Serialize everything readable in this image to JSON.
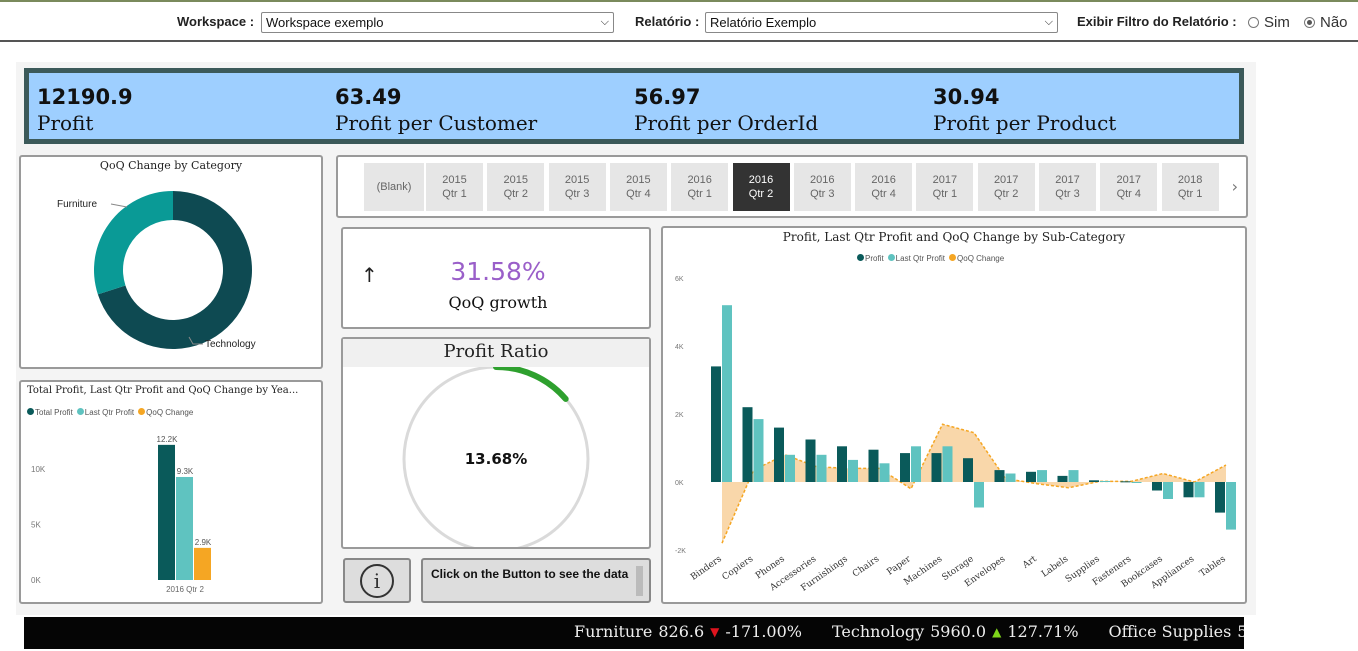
{
  "toolbar": {
    "workspace_label": "Workspace :",
    "workspace_value": "Workspace exemplo",
    "report_label": "Relatório :",
    "report_value": "Relatório Exemplo",
    "filter_label": "Exibir Filtro do Relatório :",
    "filter_options": [
      "Sim",
      "Não"
    ],
    "filter_selected": "Não"
  },
  "kpis": [
    {
      "value": "12190.9",
      "label": "Profit"
    },
    {
      "value": "63.49",
      "label": "Profit per Customer"
    },
    {
      "value": "56.97",
      "label": "Profit per OrderId"
    },
    {
      "value": "30.94",
      "label": "Profit per Product"
    }
  ],
  "donut": {
    "title": "QoQ Change by Category",
    "labels": [
      "Furniture",
      "Technology"
    ]
  },
  "quarter_slicer": {
    "items": [
      {
        "y": "(Blank)",
        "q": ""
      },
      {
        "y": "2015",
        "q": "Qtr 1"
      },
      {
        "y": "2015",
        "q": "Qtr 2"
      },
      {
        "y": "2015",
        "q": "Qtr 3"
      },
      {
        "y": "2015",
        "q": "Qtr 4"
      },
      {
        "y": "2016",
        "q": "Qtr 1"
      },
      {
        "y": "2016",
        "q": "Qtr 2"
      },
      {
        "y": "2016",
        "q": "Qtr 3"
      },
      {
        "y": "2016",
        "q": "Qtr 4"
      },
      {
        "y": "2017",
        "q": "Qtr 1"
      },
      {
        "y": "2017",
        "q": "Qtr 2"
      },
      {
        "y": "2017",
        "q": "Qtr 3"
      },
      {
        "y": "2017",
        "q": "Qtr 4"
      },
      {
        "y": "2018",
        "q": "Qtr 1"
      }
    ],
    "selected_index": 6,
    "next_icon": "chevron-right-icon"
  },
  "qoq_card": {
    "arrow": "↑",
    "value": "31.58%",
    "label": "QoQ growth",
    "value_color": "#9a5fc9"
  },
  "profit_ratio": {
    "title": "Profit Ratio",
    "value": "13.68%",
    "ratio": 0.1368
  },
  "buttons": {
    "info_icon": "i",
    "see_data_label": "Click on the Button to see the data"
  },
  "ticker": {
    "items": [
      {
        "name": "Furniture",
        "value": "826.6",
        "dir": "down",
        "pct": "-171.00%"
      },
      {
        "name": "Technology",
        "value": "5960.0",
        "dir": "up",
        "pct": "127.71%"
      },
      {
        "name": "Office Supplies",
        "value": "5",
        "dir": "",
        "pct": ""
      }
    ]
  },
  "colors": {
    "profit": "#0a5a5a",
    "last_qtr": "#5fc3c0",
    "qoq": "#f5a623",
    "kpi_band": "#9ecfff"
  },
  "chart_data": [
    {
      "type": "pie",
      "title": "QoQ Change by Category",
      "categories": [
        "Technology",
        "Furniture"
      ],
      "values": [
        70,
        30
      ],
      "colors": [
        "#0e4a52",
        "#0a9a96"
      ]
    },
    {
      "type": "bar",
      "title": "Total Profit, Last Qtr Profit and QoQ Change by Yea...",
      "categories": [
        "2016 Qtr 2"
      ],
      "series": [
        {
          "name": "Total Profit",
          "values": [
            12200
          ],
          "label": "12.2K"
        },
        {
          "name": "Last Qtr Profit",
          "values": [
            9300
          ],
          "label": "9.3K"
        },
        {
          "name": "QoQ Change",
          "values": [
            2900
          ],
          "label": "2.9K"
        }
      ],
      "yticks": [
        "0K",
        "5K",
        "10K"
      ],
      "ylim": [
        0,
        13000
      ]
    },
    {
      "type": "bar",
      "title": "Profit, Last Qtr Profit and QoQ Change by Sub-Category",
      "categories": [
        "Binders",
        "Copiers",
        "Phones",
        "Accessories",
        "Furnishings",
        "Chairs",
        "Paper",
        "Machines",
        "Storage",
        "Envelopes",
        "Art",
        "Labels",
        "Supplies",
        "Fasteners",
        "Bookcases",
        "Appliances",
        "Tables"
      ],
      "series": [
        {
          "name": "Profit",
          "values": [
            3400,
            2200,
            1600,
            1250,
            1050,
            950,
            850,
            850,
            700,
            350,
            300,
            180,
            50,
            20,
            -250,
            -450,
            -900
          ]
        },
        {
          "name": "Last Qtr Profit",
          "values": [
            5200,
            1850,
            800,
            800,
            650,
            550,
            1050,
            1050,
            -750,
            250,
            350,
            350,
            30,
            0,
            -500,
            -450,
            -1400
          ]
        },
        {
          "name": "QoQ Change",
          "values": [
            -1800,
            350,
            800,
            450,
            400,
            400,
            -200,
            1700,
            1450,
            100,
            -50,
            -170,
            20,
            20,
            250,
            0,
            500
          ]
        }
      ],
      "yticks": [
        "-2K",
        "0K",
        "2K",
        "4K",
        "6K"
      ],
      "ylim": [
        -2000,
        6000
      ]
    }
  ]
}
